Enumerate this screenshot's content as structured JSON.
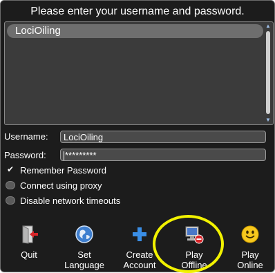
{
  "login": {
    "prompt": "Please enter your username and password.",
    "saved_users": [
      "LociOiling"
    ],
    "username_label": "Username:",
    "username_value": "LociOiling",
    "password_label": "Password:",
    "password_value": "*********",
    "options": {
      "remember": {
        "label": "Remember Password",
        "checked": true
      },
      "proxy": {
        "label": "Connect using proxy",
        "checked": false
      },
      "timeouts": {
        "label": "Disable network timeouts",
        "checked": false
      }
    }
  },
  "toolbar": {
    "quit": {
      "label": "Quit",
      "icon": "exit-door-icon"
    },
    "language": {
      "label": "Set\nLanguage",
      "icon": "globe-icon"
    },
    "create": {
      "label": "Create\nAccount",
      "icon": "plus-icon"
    },
    "offline": {
      "label": "Play\nOffline",
      "icon": "computer-offline-icon"
    },
    "online": {
      "label": "Play\nOnline",
      "icon": "smiley-icon"
    }
  },
  "annotation": {
    "highlight_color": "#f2f200"
  }
}
